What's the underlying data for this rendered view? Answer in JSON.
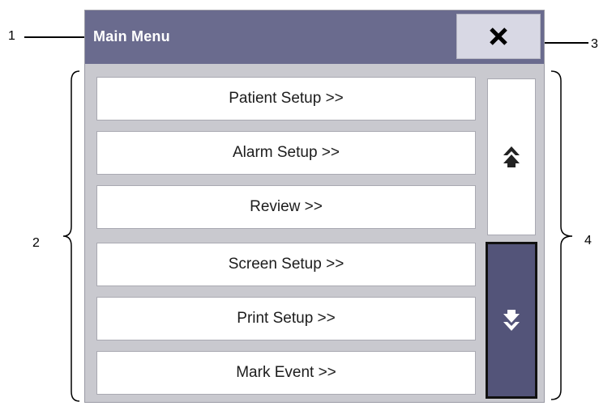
{
  "callouts": [
    "1",
    "2",
    "3",
    "4"
  ],
  "menu": {
    "title": "Main Menu",
    "close_icon": "close-x-icon",
    "items": [
      {
        "label": "Patient Setup >>"
      },
      {
        "label": "Alarm Setup >>"
      },
      {
        "label": "Review >>"
      },
      {
        "label": "Screen Setup >>"
      },
      {
        "label": "Print Setup >>"
      },
      {
        "label": "Mark Event >>"
      }
    ],
    "scroll_up_icon": "double-chevron-up-icon",
    "scroll_down_icon": "double-chevron-down-icon"
  },
  "colors": {
    "titlebar": "#6a6b8e",
    "panel_background": "#c9c9cf",
    "scroll_down_active": "#535479"
  }
}
